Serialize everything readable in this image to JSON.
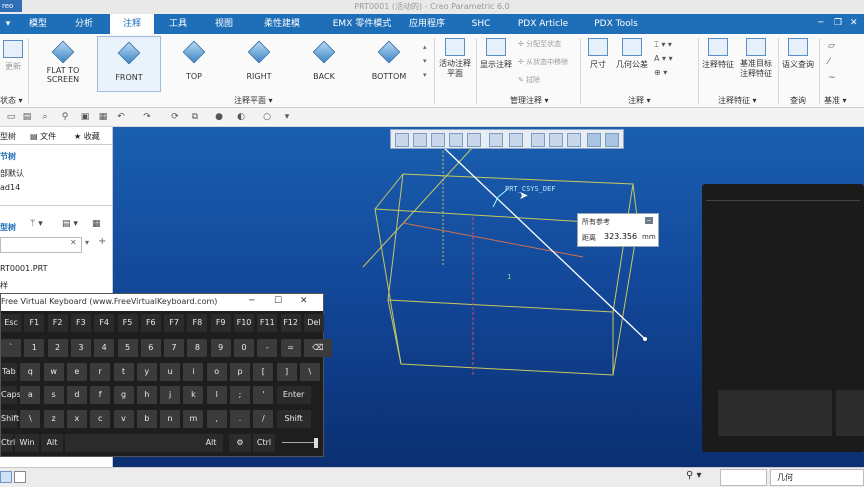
{
  "window": {
    "app_title": "PRT0001 (活动的) - Creo Parametric 6.0",
    "logo_text": "reo",
    "minimize": "─",
    "restore": "❐",
    "close": "✕"
  },
  "menu_tabs": [
    {
      "label": "模型"
    },
    {
      "label": "分析"
    },
    {
      "label": "注释"
    },
    {
      "label": "工具"
    },
    {
      "label": "视图"
    },
    {
      "label": "柔性建模"
    },
    {
      "label": "EMX 零件模式"
    },
    {
      "label": "应用程序"
    },
    {
      "label": "SHC"
    },
    {
      "label": "PDX Article"
    },
    {
      "label": "PDX Tools"
    }
  ],
  "ribbon": {
    "left_partial_label": "更新",
    "left_partial_group": "状态 ▾",
    "views": [
      {
        "label": "FLAT TO SCREEN"
      },
      {
        "label": "FRONT"
      },
      {
        "label": "TOP"
      },
      {
        "label": "RIGHT"
      },
      {
        "label": "BACK"
      },
      {
        "label": "BOTTOM"
      }
    ],
    "group_annotation_plane": "注释平面 ▾",
    "active_annotation_plane": "活动注释平面",
    "show_annotation": "显示注释",
    "assign_state": "分配至状态",
    "remove_from_state": "从状态中移除",
    "erase": "拭除",
    "group_manage": "管理注释 ▾",
    "dimension": "尺寸",
    "geometric_tolerance": "几何公差",
    "group_annotation": "注释 ▾",
    "annotation_feature": "注释特征",
    "datum_target_feature": "基准目标注释特征",
    "group_annotation_feature": "注释特征 ▾",
    "semantic_query": "语义查询",
    "group_query": "查询",
    "group_datum": "基准 ▾"
  },
  "left_panel": {
    "tab_model_tree": "型树",
    "tab_folder": "文件",
    "tab_favorites": "收藏",
    "section_tree": "节树",
    "default_item": "部默认",
    "item_ad14": "ad14",
    "section_model_tree": "型树",
    "root_part": "RT0001.PRT",
    "root_child": "样"
  },
  "graphics": {
    "csys_label": "PRT_CSYS_DEF",
    "axis_label": "1"
  },
  "measure": {
    "header": "所有参考",
    "label": "距离",
    "value": "323.356",
    "unit": "mm"
  },
  "keyboard": {
    "title": "Free Virtual Keyboard (www.FreeVirtualKeyboard.com)",
    "rows": [
      [
        "Esc",
        "F1",
        "F2",
        "F3",
        "F4",
        "F5",
        "F6",
        "F7",
        "F8",
        "F9",
        "F10",
        "F11",
        "F12",
        "Del"
      ],
      [
        "`",
        "1",
        "2",
        "3",
        "4",
        "5",
        "6",
        "7",
        "8",
        "9",
        "0",
        "-",
        "=",
        "⌫"
      ],
      [
        "Tab",
        "q",
        "w",
        "e",
        "r",
        "t",
        "y",
        "u",
        "i",
        "o",
        "p",
        "[",
        "]",
        "\\"
      ],
      [
        "Caps",
        "a",
        "s",
        "d",
        "f",
        "g",
        "h",
        "j",
        "k",
        "l",
        ";",
        "'",
        "Enter"
      ],
      [
        "Shift",
        "\\",
        "z",
        "x",
        "c",
        "v",
        "b",
        "n",
        "m",
        ",",
        ".",
        "/",
        "Shift"
      ],
      [
        "Ctrl",
        "Win",
        "Alt",
        "",
        "Alt",
        "⚙",
        "Ctrl"
      ]
    ]
  },
  "statusbar": {
    "filter": "几何"
  },
  "colors": {
    "menu_blue": "#1e6fb8",
    "graphics_top": "#1a5fb0",
    "graphics_bottom": "#0b2f72",
    "wire_yellow": "#c8c860",
    "measure_line": "#ffffff"
  }
}
